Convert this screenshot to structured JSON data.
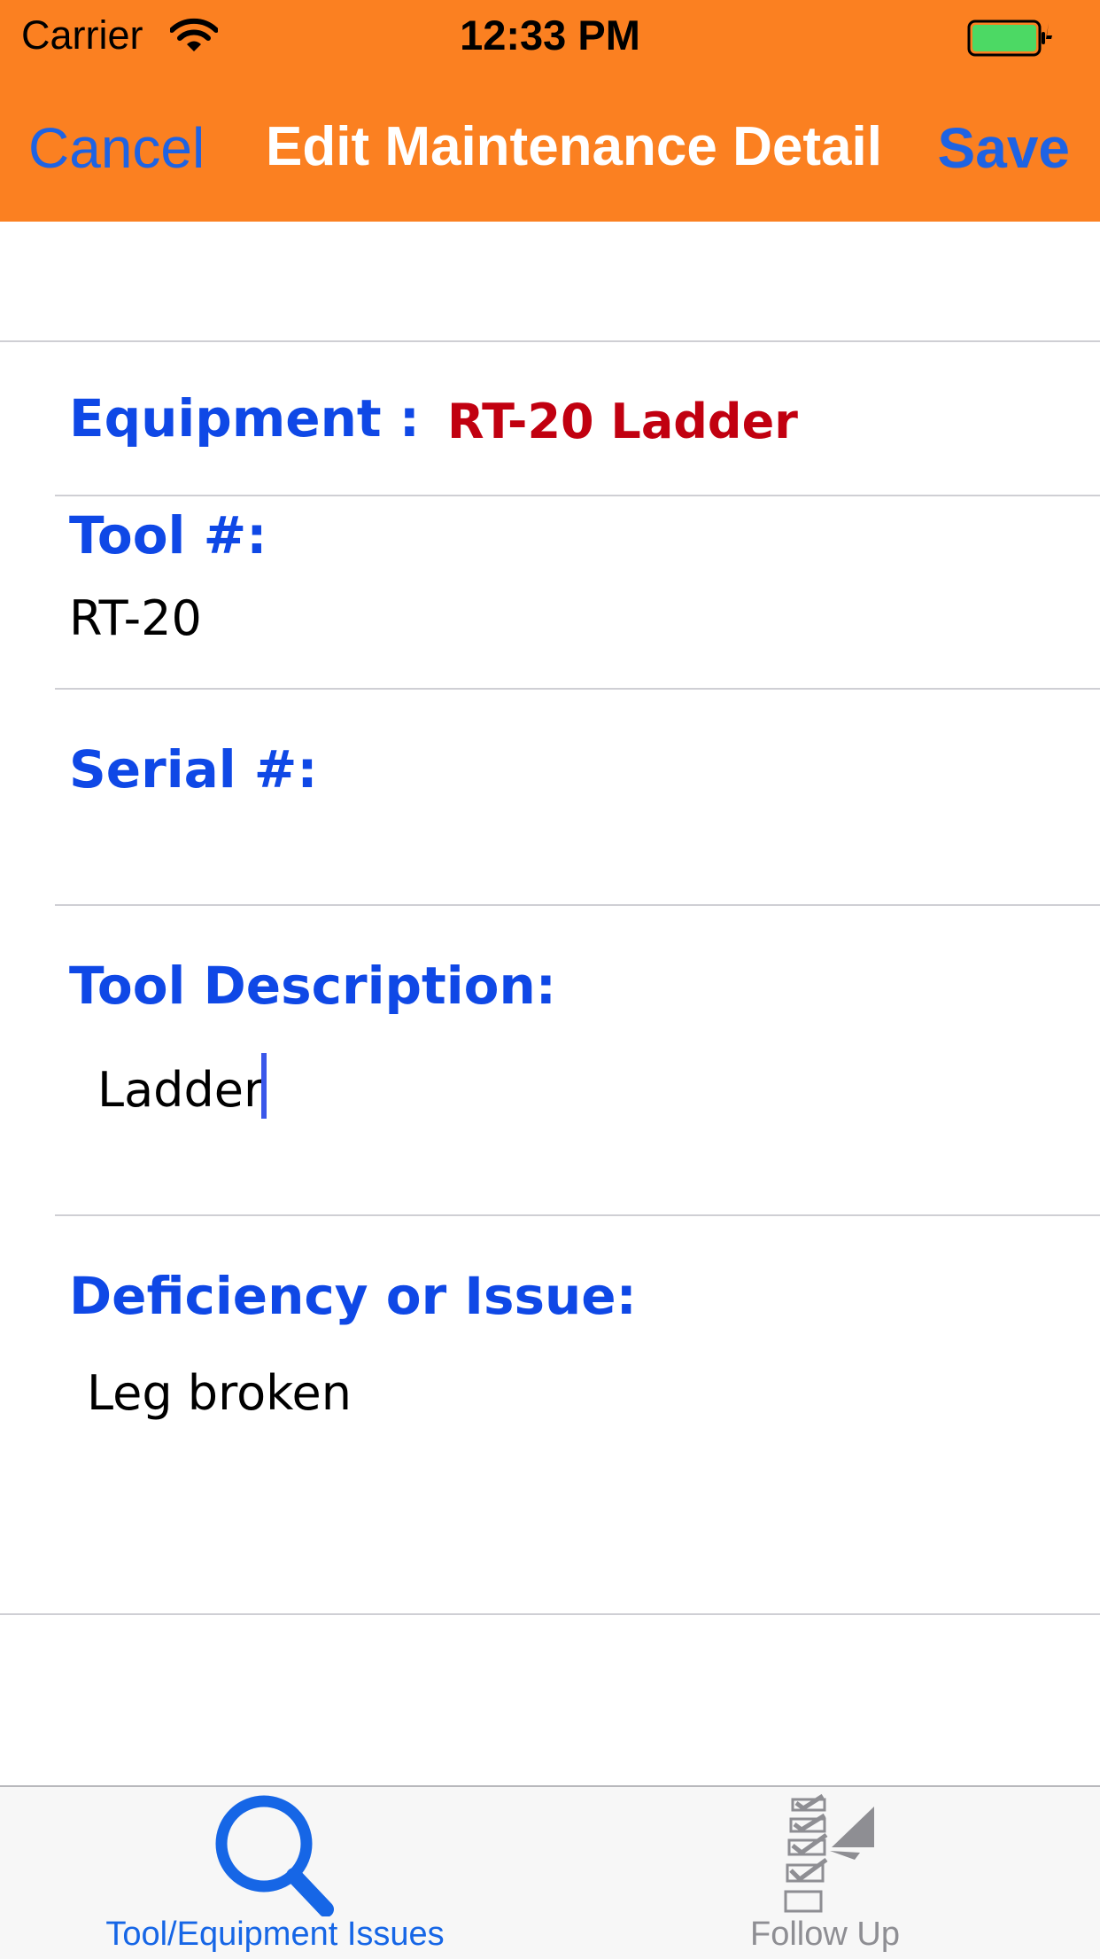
{
  "status_bar": {
    "carrier": "Carrier",
    "time": "12:33 PM"
  },
  "nav": {
    "cancel_label": "Cancel",
    "title": "Edit Maintenance Detail",
    "save_label": "Save"
  },
  "form": {
    "equipment_label": "Equipment :",
    "equipment_value": "RT-20 Ladder",
    "tool_number_label": "Tool #:",
    "tool_number_value": "RT-20",
    "serial_label": "Serial #:",
    "serial_value": "",
    "description_label": "Tool Description:",
    "description_value": "Ladder",
    "deficiency_label": "Deficiency or Issue:",
    "deficiency_value": "Leg broken"
  },
  "tabbar": {
    "tabs": [
      {
        "label": "Tool/Equipment Issues",
        "icon": "search-icon",
        "selected": true
      },
      {
        "label": "Follow Up",
        "icon": "checklist-icon",
        "selected": false
      }
    ]
  },
  "colors": {
    "bar_background": "#fb8021",
    "accent_blue": "#1e63e3",
    "label_blue": "#0f48e6",
    "equipment_red": "#c10010"
  }
}
